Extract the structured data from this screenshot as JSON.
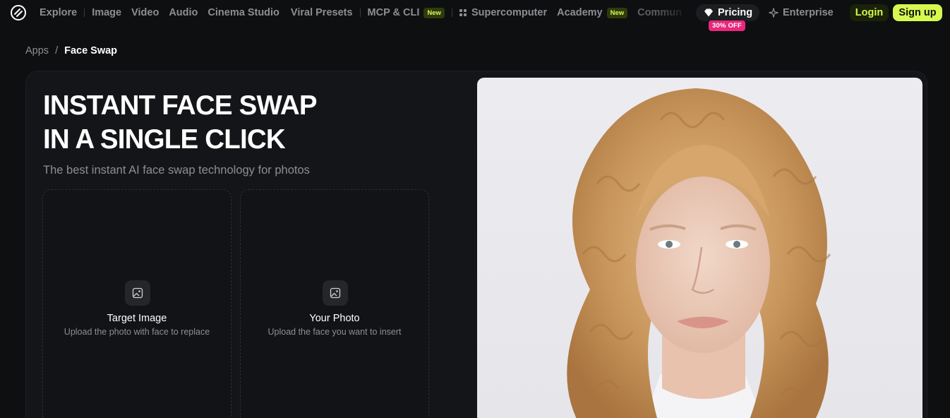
{
  "nav": {
    "items": [
      {
        "label": "Explore"
      },
      {
        "label": "Image"
      },
      {
        "label": "Video"
      },
      {
        "label": "Audio"
      },
      {
        "label": "Cinema Studio"
      },
      {
        "label": "Viral Presets"
      },
      {
        "label": "MCP & CLI",
        "badge": "New"
      },
      {
        "label": "Supercomputer"
      },
      {
        "label": "Academy",
        "badge": "New"
      },
      {
        "label": "Commun"
      }
    ],
    "pricing": "Pricing",
    "pricing_badge": "30% OFF",
    "enterprise": "Enterprise",
    "login": "Login",
    "signup": "Sign up"
  },
  "breadcrumb": {
    "root": "Apps",
    "separator": "/",
    "current": "Face Swap"
  },
  "hero": {
    "title_line1": "INSTANT FACE SWAP",
    "title_line2": "IN A SINGLE CLICK",
    "subtitle": "The best instant AI face swap technology for photos"
  },
  "uploads": [
    {
      "title": "Target Image",
      "description": "Upload the photo with face to replace"
    },
    {
      "title": "Your Photo",
      "description": "Upload the face you want to insert"
    }
  ],
  "colors": {
    "accent": "#d6f84f",
    "badge_pink": "#e8287c",
    "background": "#0e0f11"
  }
}
